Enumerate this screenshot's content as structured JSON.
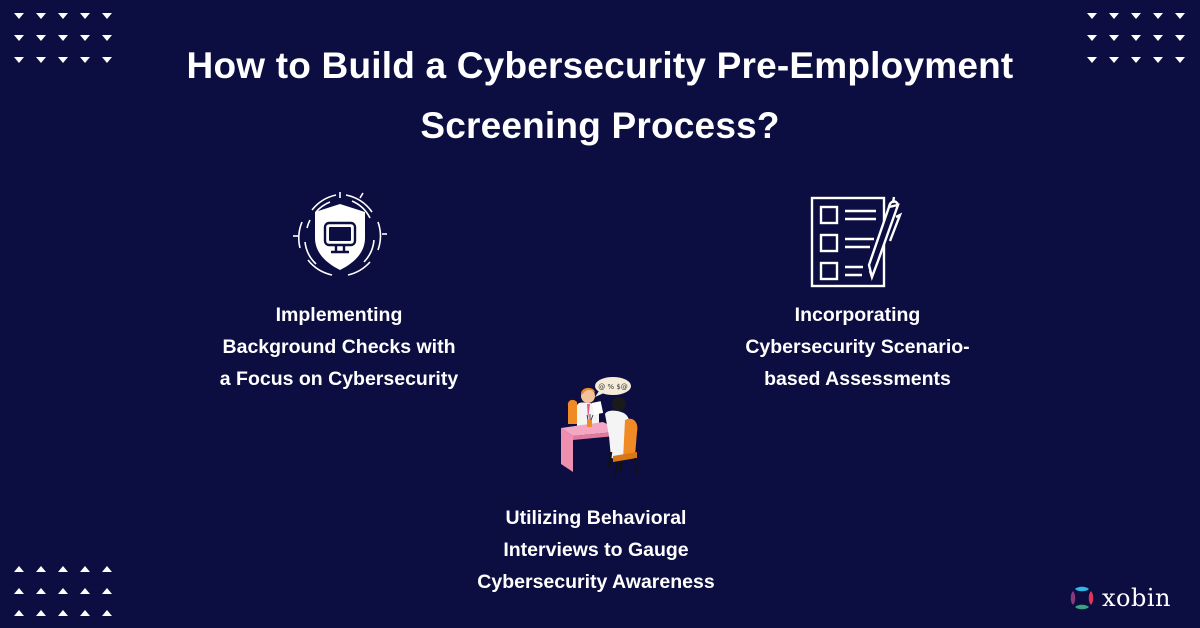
{
  "title": {
    "lines": [
      "How to Build a Cybersecurity Pre-Employment",
      "Screening Process?"
    ]
  },
  "items": [
    {
      "icon": "shield-monitor-icon",
      "lines": [
        "Implementing",
        "Background Checks with",
        "a Focus on Cybersecurity"
      ]
    },
    {
      "icon": "checklist-pen-icon",
      "lines": [
        "Incorporating",
        "Cybersecurity Scenario-",
        "based Assessments"
      ]
    },
    {
      "icon": "interview-illustration-icon",
      "lines": [
        "Utilizing Behavioral",
        "Interviews to Gauge",
        "Cybersecurity Awareness"
      ]
    }
  ],
  "speech_bubble": {
    "text": "@ % $@"
  },
  "brand": {
    "name": "xobin"
  },
  "colors": {
    "background": "#0c0d40",
    "text": "#ffffff",
    "logo_top": "#2fb7e6",
    "logo_right": "#e1345a",
    "logo_bottom": "#3aa381",
    "logo_left": "#8a3a7a",
    "desk_pink": "#ee8fb0",
    "chair_orange": "#f08a24"
  }
}
